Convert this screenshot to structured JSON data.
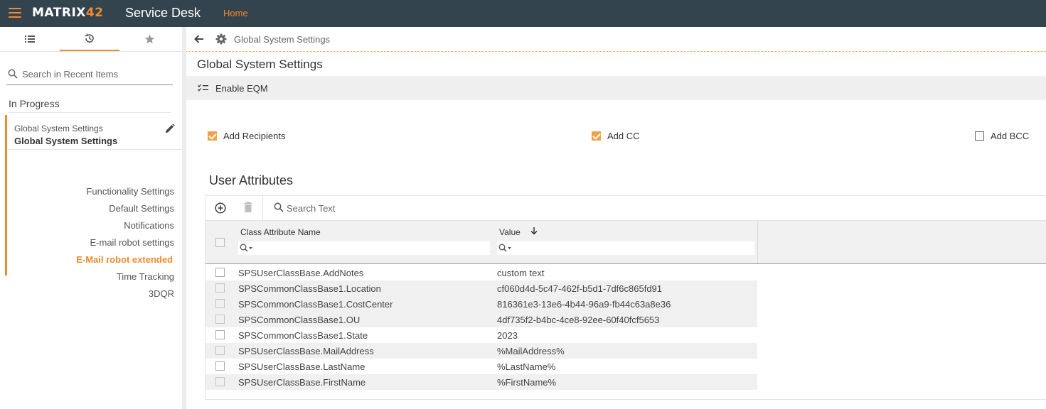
{
  "header": {
    "logo_main": "MATRIX",
    "logo_num": "42",
    "app_title": "Service Desk",
    "home_link": "Home"
  },
  "sidebar": {
    "tabs": [
      {
        "icon": "list-icon"
      },
      {
        "icon": "history-icon",
        "active": true
      },
      {
        "icon": "star-icon"
      }
    ],
    "search_placeholder": "Search in Recent Items",
    "section_title": "In Progress",
    "item_subtitle": "Global System Settings",
    "item_title": "Global System Settings",
    "links": [
      "Functionality Settings",
      "Default Settings",
      "Notifications",
      "E-mail robot settings",
      "E-Mail robot extended",
      "Time Tracking",
      "3DQR"
    ],
    "active_link": "E-Mail robot extended"
  },
  "main": {
    "breadcrumb": "Global System Settings",
    "page_title": "Global System Settings",
    "toolbar_button": "Enable EQM",
    "checkboxes": [
      {
        "label": "Add Recipients",
        "checked": true
      },
      {
        "label": "Add CC",
        "checked": true
      },
      {
        "label": "Add BCC",
        "checked": false
      }
    ],
    "section_title": "User Attributes",
    "grid": {
      "search_placeholder": "Search Text",
      "columns": [
        "Class Attribute Name",
        "Value"
      ],
      "sort_column": "Value",
      "rows": [
        {
          "name": "SPSUserClassBase.AddNotes",
          "value": "custom text"
        },
        {
          "name": "SPSCommonClassBase1.Location",
          "value": "cf060d4d-5c47-462f-b5d1-7df6c865fd91"
        },
        {
          "name": "SPSCommonClassBase1.CostCenter",
          "value": "816361e3-13e6-4b44-96a9-fb44c63a8e36"
        },
        {
          "name": "SPSCommonClassBase1.OU",
          "value": "4df735f2-b4bc-4ce8-92ee-60f40fcf5653"
        },
        {
          "name": "SPSCommonClassBase1.State",
          "value": "2023"
        },
        {
          "name": "SPSUserClassBase.MailAddress",
          "value": "%MailAddress%"
        },
        {
          "name": "SPSUserClassBase.LastName",
          "value": "%LastName%"
        },
        {
          "name": "SPSUserClassBase.FirstName",
          "value": "%FirstName%"
        }
      ]
    }
  },
  "colors": {
    "topbar": "#34444f",
    "accent": "#f08a2c",
    "checkbox_on": "#f0a24a"
  }
}
